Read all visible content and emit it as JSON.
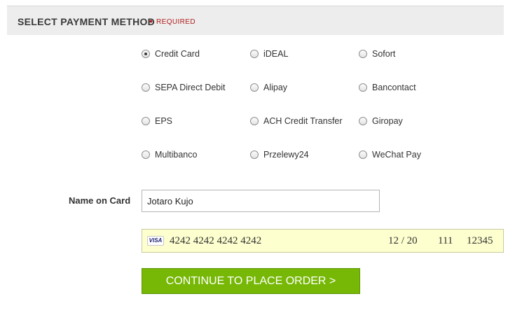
{
  "header": {
    "title": "SELECT PAYMENT METHOD",
    "required_marker": "•",
    "required_label": "REQUIRED"
  },
  "payment_methods": {
    "selected": "Credit Card",
    "options": [
      {
        "label": "Credit Card",
        "checked": true
      },
      {
        "label": "iDEAL",
        "checked": false
      },
      {
        "label": "Sofort",
        "checked": false
      },
      {
        "label": "SEPA Direct Debit",
        "checked": false
      },
      {
        "label": "Alipay",
        "checked": false
      },
      {
        "label": "Bancontact",
        "checked": false
      },
      {
        "label": "EPS",
        "checked": false
      },
      {
        "label": "ACH Credit Transfer",
        "checked": false
      },
      {
        "label": "Giropay",
        "checked": false
      },
      {
        "label": "Multibanco",
        "checked": false
      },
      {
        "label": "Przelewy24",
        "checked": false
      },
      {
        "label": "WeChat Pay",
        "checked": false
      }
    ]
  },
  "card_form": {
    "name_label": "Name on Card",
    "name_value": "Jotaro Kujo",
    "card_brand_icon": "visa-icon",
    "card_brand_text": "VISA",
    "card_number": "4242 4242 4242 4242",
    "expiry": "12 / 20",
    "cvc": "111",
    "postal_code": "12345"
  },
  "actions": {
    "continue_label": "CONTINUE TO PLACE ORDER >"
  },
  "colors": {
    "header_band": "#ededed",
    "required_red": "#b01c1c",
    "card_field_bg": "#fdffce",
    "continue_button": "#77b806"
  }
}
